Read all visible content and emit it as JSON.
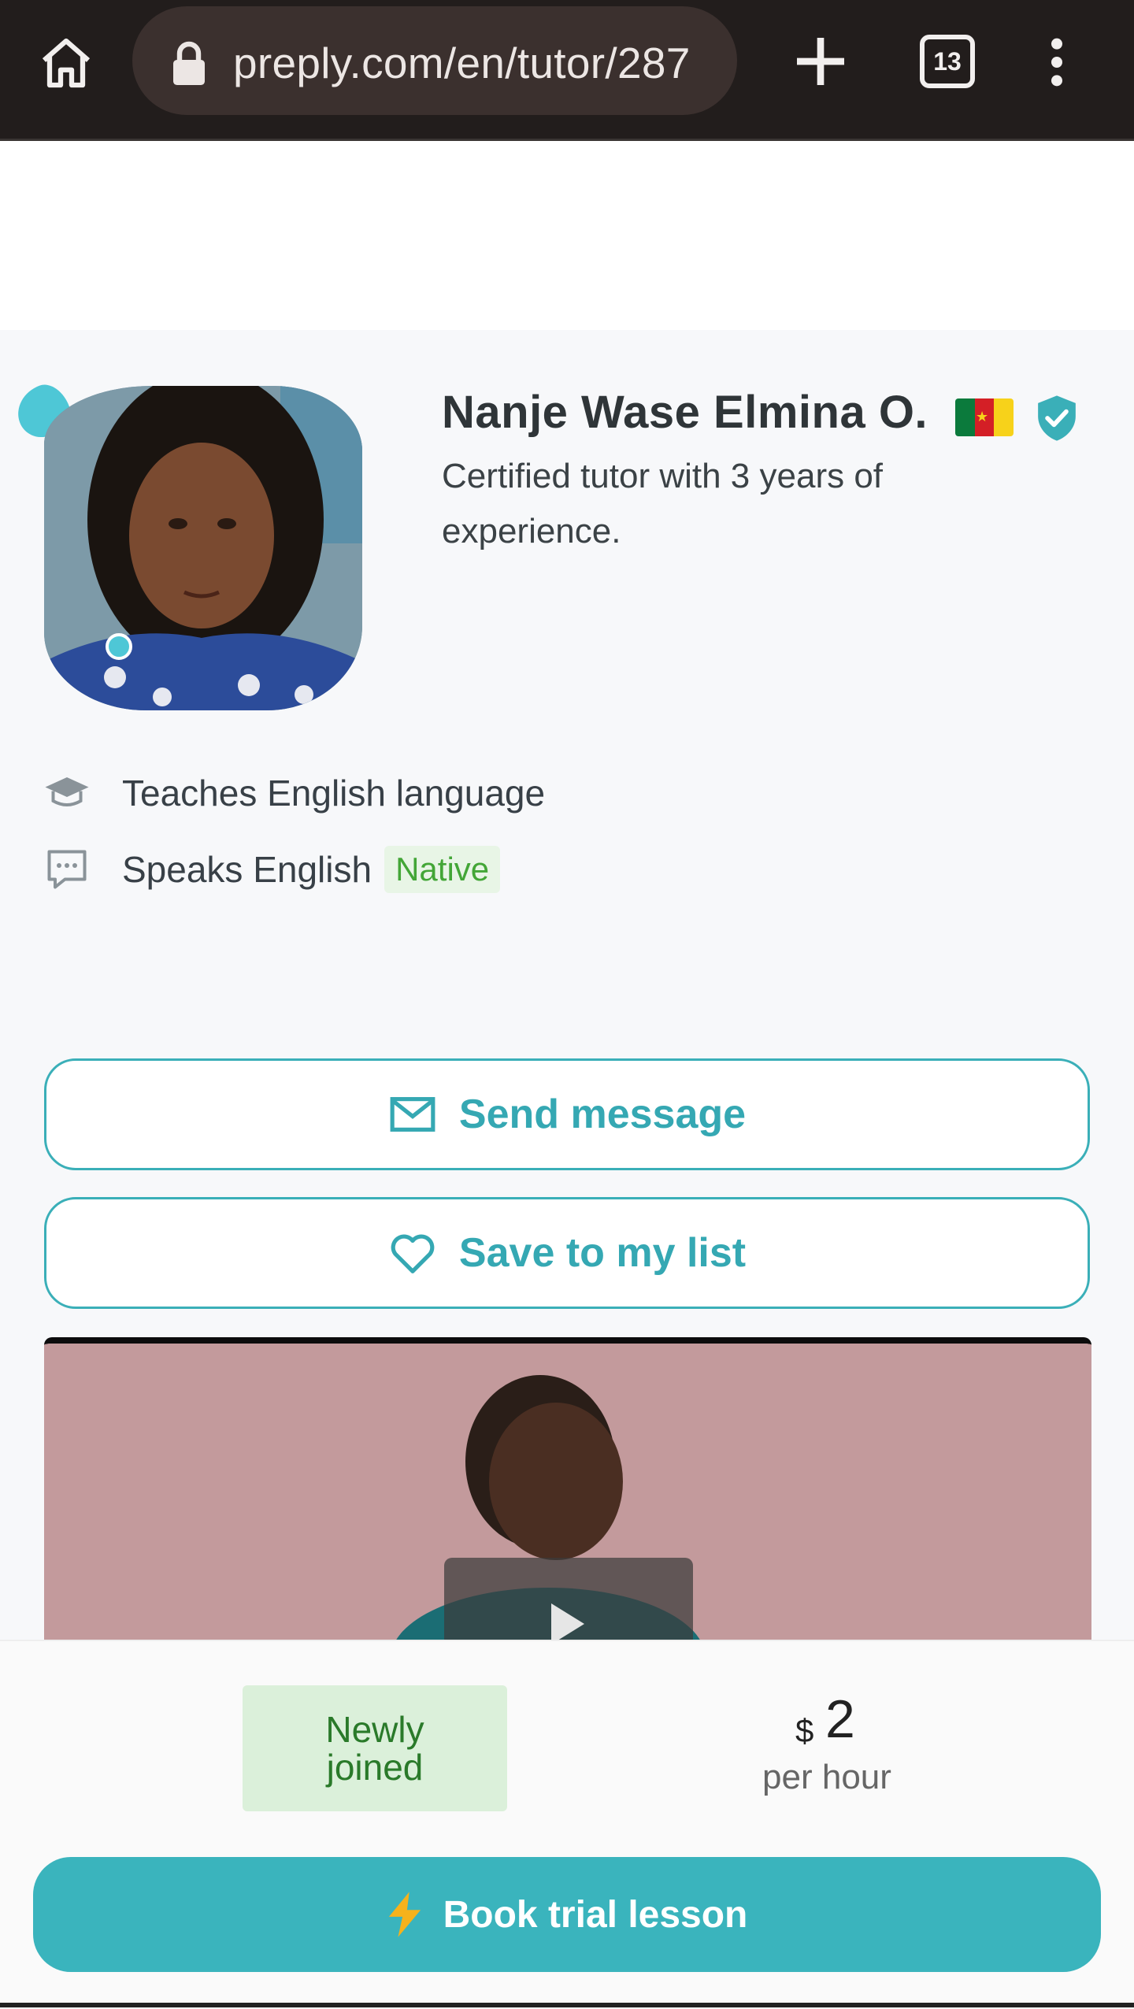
{
  "browser": {
    "url": "preply.com/en/tutor/287",
    "tab_count": "13"
  },
  "tutor": {
    "name": "Nanje Wase Elmina O.",
    "tagline": "Certified tutor with 3 years of experience.",
    "teaches": "Teaches English language",
    "speaks": "Speaks English",
    "native_label": "Native"
  },
  "actions": {
    "send_message": "Send message",
    "save_to_list": "Save to my list"
  },
  "booking": {
    "newly_line1": "Newly",
    "newly_line2": "joined",
    "currency": "$",
    "price": "2",
    "per_hour": "per hour",
    "book_label": "Book trial lesson"
  },
  "colors": {
    "accent": "#3ab4bd",
    "native_green": "#43a637",
    "chrome_bg": "#221d1c"
  },
  "icons": [
    "home-icon",
    "lock-icon",
    "plus-icon",
    "tabs-icon",
    "more-vert-icon",
    "graduation-cap-icon",
    "chat-icon",
    "mail-icon",
    "heart-icon",
    "play-icon",
    "bolt-icon",
    "verified-shield-icon"
  ]
}
